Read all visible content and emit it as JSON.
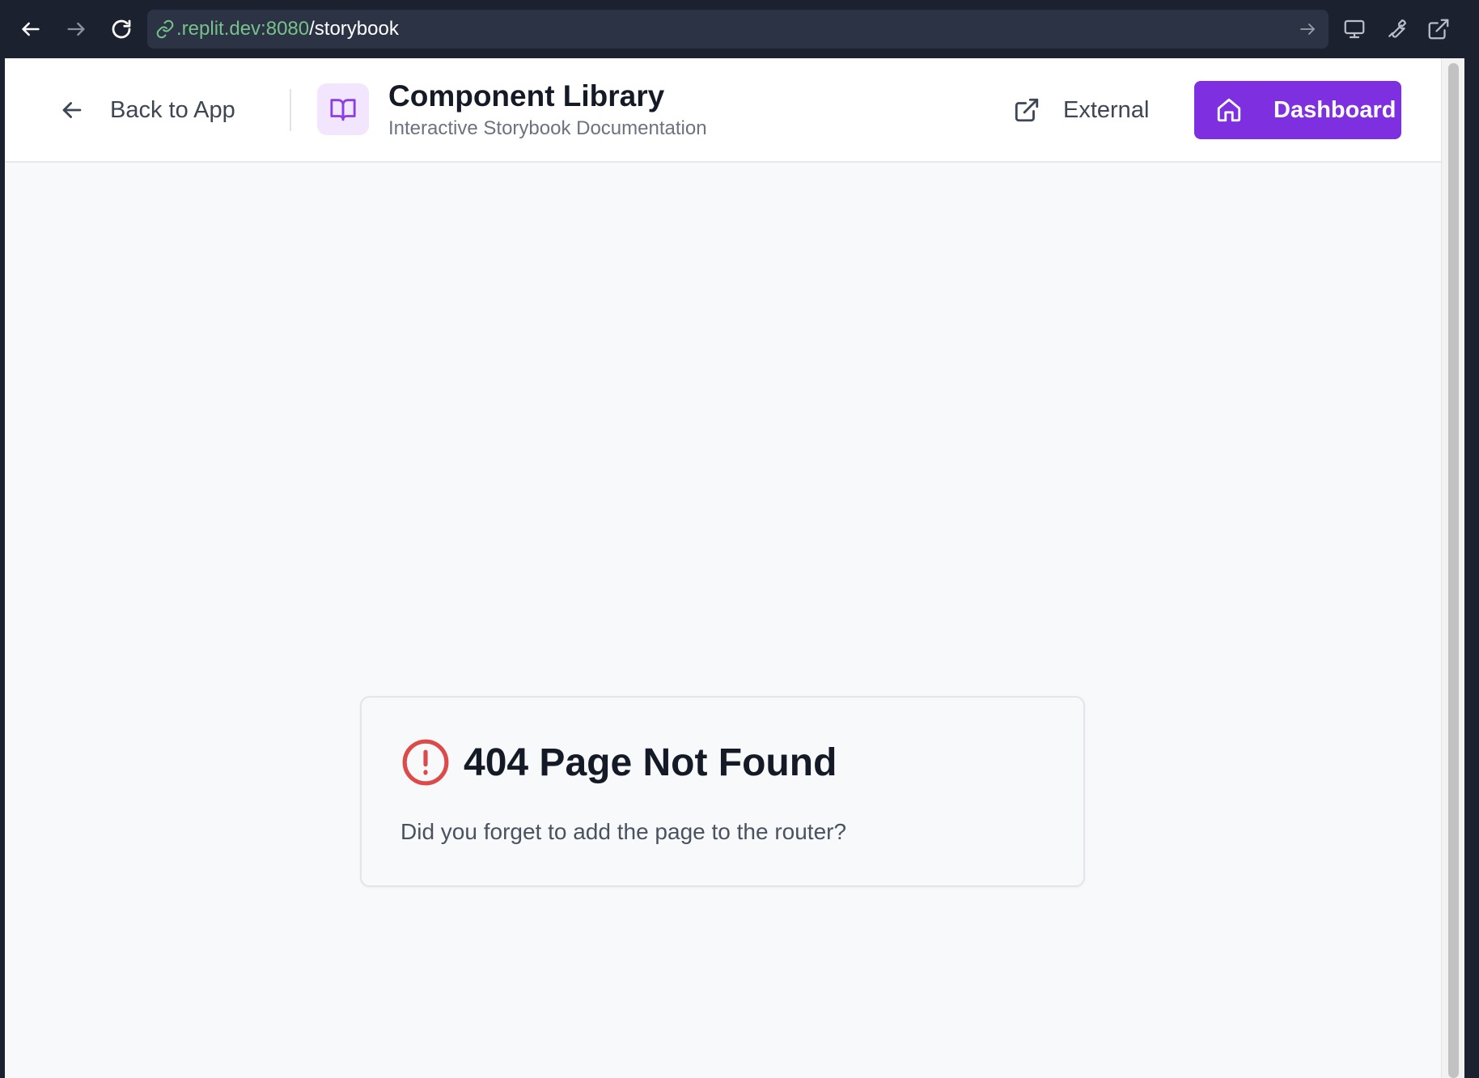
{
  "browser": {
    "url_host": ".replit.dev:8080",
    "url_path": "/storybook",
    "icons": {
      "back": "arrow-left-icon",
      "forward": "arrow-right-icon",
      "reload": "reload-icon",
      "link": "link-icon",
      "go": "arrow-right-icon",
      "devices": "monitor-icon",
      "tools": "wrench-icon",
      "open_new": "external-link-icon"
    }
  },
  "header": {
    "back_label": "Back to App",
    "title": "Component Library",
    "subtitle": "Interactive Storybook Documentation",
    "external_label": "External",
    "dashboard_label": "Dashboard"
  },
  "not_found": {
    "title": "404 Page Not Found",
    "message": "Did you forget to add the page to the router?"
  },
  "colors": {
    "accent": "#7e2fe0",
    "accent_light": "#f1e6fd",
    "error": "#dc4a4a",
    "chrome_bg": "#1c2130",
    "url_host": "#77c28a"
  }
}
